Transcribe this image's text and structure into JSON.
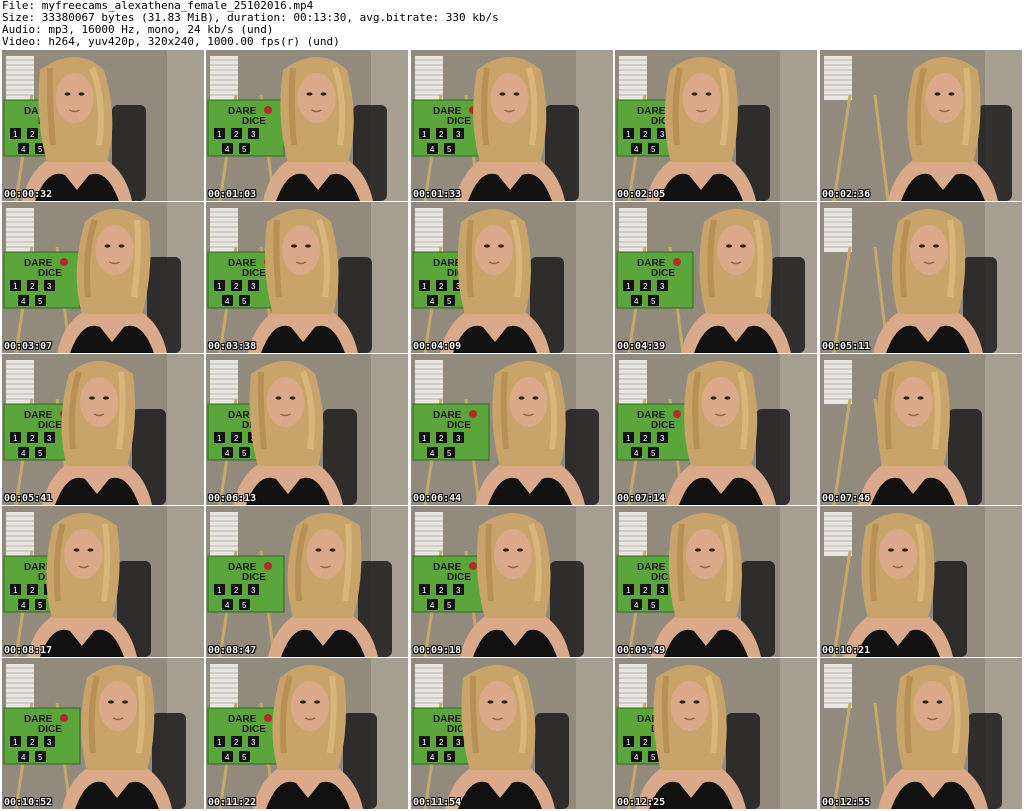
{
  "header": {
    "file": "File: myfreecams_alexathena_female_25102016.mp4",
    "size": "Size: 33380067 bytes (31.83 MiB), duration: 00:13:30, avg.bitrate: 330 kb/s",
    "audio": "Audio: mp3, 16000 Hz, mono, 24 kb/s (und)",
    "video": "Video: h264, yuv420p, 320x240, 1000.00 fps(r) (und)"
  },
  "board_text": {
    "dare": "DARE",
    "dice": "DICE",
    "nums": [
      "1",
      "2",
      "3",
      "4",
      "5"
    ]
  },
  "thumbnails": [
    {
      "time": "00:00:32"
    },
    {
      "time": "00:01:03"
    },
    {
      "time": "00:01:33"
    },
    {
      "time": "00:02:05"
    },
    {
      "time": "00:02:36"
    },
    {
      "time": "00:03:07"
    },
    {
      "time": "00:03:38"
    },
    {
      "time": "00:04:09"
    },
    {
      "time": "00:04:39"
    },
    {
      "time": "00:05:11"
    },
    {
      "time": "00:05:41"
    },
    {
      "time": "00:06:13"
    },
    {
      "time": "00:06:44"
    },
    {
      "time": "00:07:14"
    },
    {
      "time": "00:07:46"
    },
    {
      "time": "00:08:17"
    },
    {
      "time": "00:08:47"
    },
    {
      "time": "00:09:18"
    },
    {
      "time": "00:09:49"
    },
    {
      "time": "00:10:21"
    },
    {
      "time": "00:10:52"
    },
    {
      "time": "00:11:22"
    },
    {
      "time": "00:11:54"
    },
    {
      "time": "00:12:25"
    },
    {
      "time": "00:12:55"
    }
  ],
  "colors": {
    "wall": "#8a8478",
    "board": "#5aa63a",
    "hair": "#c9a46a",
    "skin": "#d9a98a",
    "top": "#111111",
    "timestamp": "#ffffff"
  }
}
